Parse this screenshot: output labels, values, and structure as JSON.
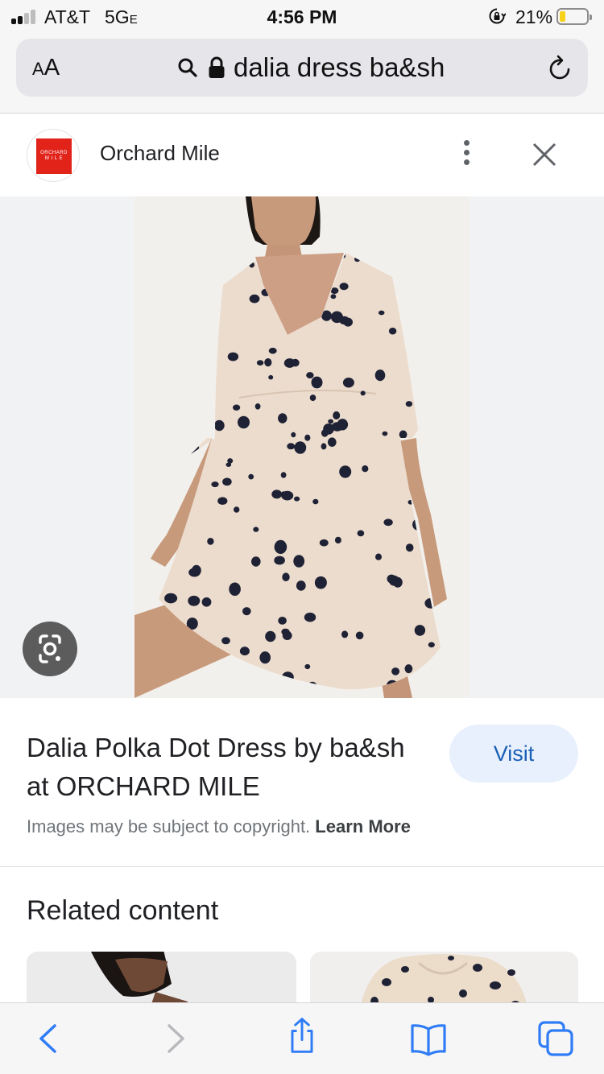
{
  "status_bar": {
    "carrier": "AT&T",
    "network_main": "5G",
    "network_suffix": "E",
    "time": "4:56 PM",
    "battery_percent": "21%",
    "battery_level": 0.21,
    "battery_color": "#f7d21b",
    "signal_bars_active": 2,
    "icons": [
      "signal-icon",
      "orientation-lock-icon",
      "battery-icon"
    ]
  },
  "browser": {
    "text_size_label_small": "A",
    "text_size_label_large": "A",
    "url_text": "dalia dress ba&sh",
    "icons": [
      "search-icon",
      "lock-icon",
      "reload-icon"
    ]
  },
  "source": {
    "favicon_text_line1": "ORCHARD",
    "favicon_text_line2": "M I L E",
    "name": "Orchard Mile",
    "icons": [
      "more-options-icon",
      "close-icon"
    ],
    "brand_color": "#e2231a"
  },
  "image": {
    "lens_icon": "google-lens-icon"
  },
  "result": {
    "title": "Dalia Polka Dot Dress by ba&sh at ORCHARD MILE",
    "visit_label": "Visit",
    "copyright_text": "Images may be subject to copyright.",
    "learn_more": "Learn More",
    "accent_color": "#1a5fb4"
  },
  "related": {
    "title": "Related content"
  },
  "toolbar": {
    "icons": [
      "back-icon",
      "forward-icon",
      "share-icon",
      "bookmarks-icon",
      "tabs-icon"
    ],
    "accent_color": "#2f7cf6"
  }
}
